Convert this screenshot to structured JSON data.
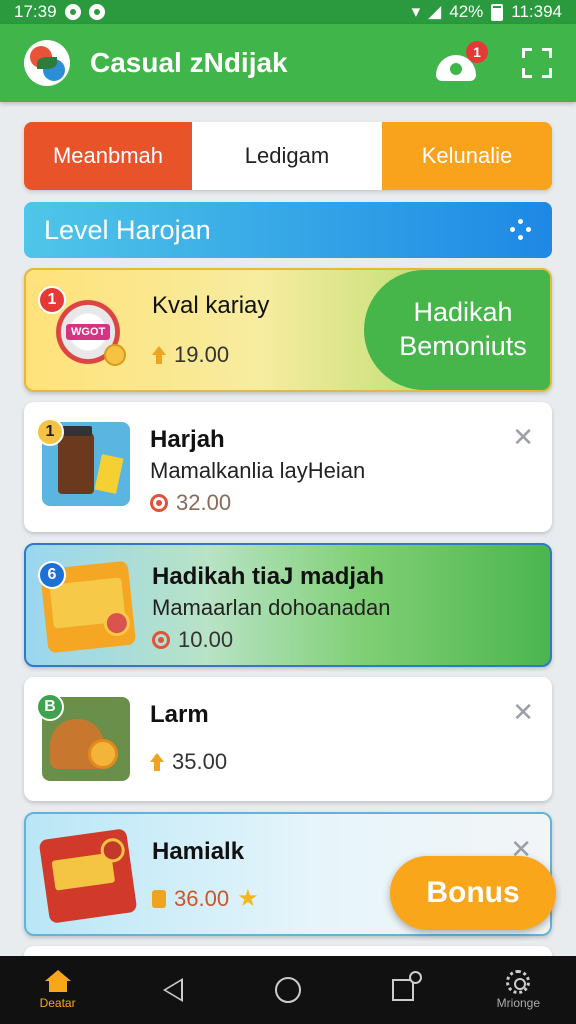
{
  "status_bar": {
    "time_left": "17:39",
    "battery": "42%",
    "time_right": "11:394"
  },
  "app": {
    "title": "Casual zNdijak",
    "notification_count": "1"
  },
  "tabs": [
    {
      "label": "Meanbmah"
    },
    {
      "label": "Ledigam"
    },
    {
      "label": "Kelunalie"
    }
  ],
  "level_banner": {
    "label": "Level Harojan"
  },
  "cards": [
    {
      "badge": "1",
      "title": "Kval kariay",
      "subtitle": "",
      "price": "19.00",
      "side_label": "Hadikah Bemoniuts",
      "thumb_text": "WGOT"
    },
    {
      "badge": "1",
      "title": "Harjah",
      "subtitle": "Mamalkanlia layHeian",
      "price": "32.00"
    },
    {
      "badge": "6",
      "title": "Hadikah tiaJ madjah",
      "subtitle": "Mamaarlan dohoanadan",
      "price": "10.00"
    },
    {
      "badge": "B",
      "title": "Larm",
      "subtitle": "",
      "price": "35.00"
    },
    {
      "badge": "",
      "title": "Hamialk",
      "subtitle": "",
      "price": "36.00"
    }
  ],
  "fab": {
    "label": "Bonus"
  },
  "navbar": {
    "items": [
      {
        "label": "Deatar"
      },
      {
        "label": ""
      },
      {
        "label": ""
      },
      {
        "label": ""
      },
      {
        "label": "Mrionge"
      }
    ]
  },
  "colors": {
    "primary_green": "#3fb54a",
    "orange": "#f9a61b",
    "red_orange": "#e8532a",
    "blue": "#1e88e5"
  }
}
